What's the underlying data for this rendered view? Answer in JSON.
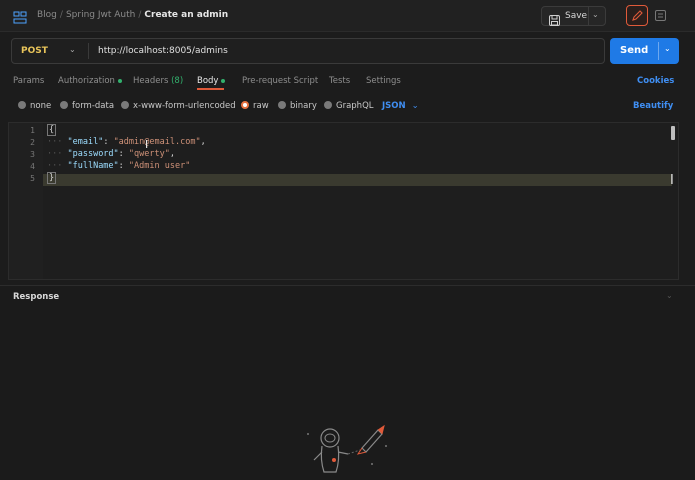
{
  "header": {
    "breadcrumb": [
      "Blog",
      "Spring Jwt Auth",
      "Create an admin"
    ],
    "separator": "/",
    "save_label": "Save"
  },
  "request": {
    "method": "POST",
    "url": "http://localhost:8005/admins",
    "send_label": "Send"
  },
  "tabs": [
    {
      "label": "Params"
    },
    {
      "label": "Authorization",
      "dot": true
    },
    {
      "label": "Headers",
      "count": "(8)"
    },
    {
      "label": "Body",
      "dot": true,
      "active": true
    },
    {
      "label": "Pre-request Script"
    },
    {
      "label": "Tests"
    },
    {
      "label": "Settings"
    }
  ],
  "cookies_label": "Cookies",
  "body_types": [
    {
      "label": "none"
    },
    {
      "label": "form-data"
    },
    {
      "label": "x-www-form-urlencoded"
    },
    {
      "label": "raw",
      "selected": true
    },
    {
      "label": "binary"
    },
    {
      "label": "GraphQL"
    }
  ],
  "body_format": "JSON",
  "beautify_label": "Beautify",
  "editor": {
    "line_numbers": [
      "1",
      "2",
      "3",
      "4",
      "5"
    ],
    "open_brace": "{",
    "close_brace": "}",
    "fields": [
      {
        "key": "\"email\"",
        "value": "\"admin@email.com\"",
        "comma": ","
      },
      {
        "key": "\"password\"",
        "value": "\"qwerty\"",
        "comma": ","
      },
      {
        "key": "\"fullName\"",
        "value": "\"Admin user\"",
        "comma": ""
      }
    ]
  },
  "response": {
    "title": "Response"
  },
  "colors": {
    "accent": "#e05a3a",
    "send": "#1f7ae6",
    "link": "#3f8ef2",
    "method": "#e8c45a",
    "status_dot": "#32b06d"
  },
  "icons": [
    "collection-icon",
    "save-icon",
    "chevron-down-icon",
    "pencil-icon",
    "document-icon",
    "astronaut-rocket-illustration"
  ]
}
